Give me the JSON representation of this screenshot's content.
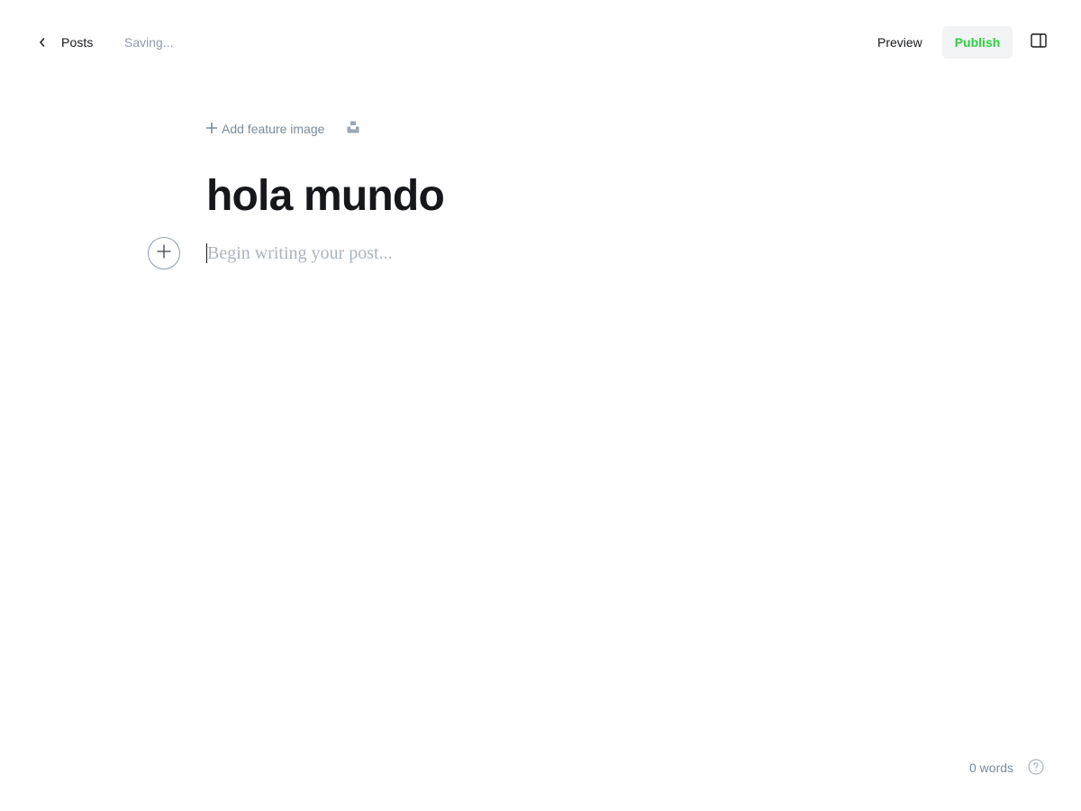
{
  "topbar": {
    "back_label": "Posts",
    "status": "Saving...",
    "preview_label": "Preview",
    "publish_label": "Publish"
  },
  "editor": {
    "add_feature_label": "Add feature image",
    "title": "hola mundo",
    "body_placeholder": "Begin writing your post..."
  },
  "footer": {
    "word_count": "0 words"
  },
  "icons": {
    "back": "chevron-left-icon",
    "feature_add": "plus-icon",
    "unsplash": "unsplash-icon",
    "sidebar_toggle": "sidebar-toggle-icon",
    "card_menu": "plus-circle-icon",
    "help": "question-circle-icon"
  },
  "colors": {
    "publish": "#30cf43",
    "publish_bg": "#f1f3f4",
    "muted": "#8e9cac",
    "text": "#15171a"
  }
}
